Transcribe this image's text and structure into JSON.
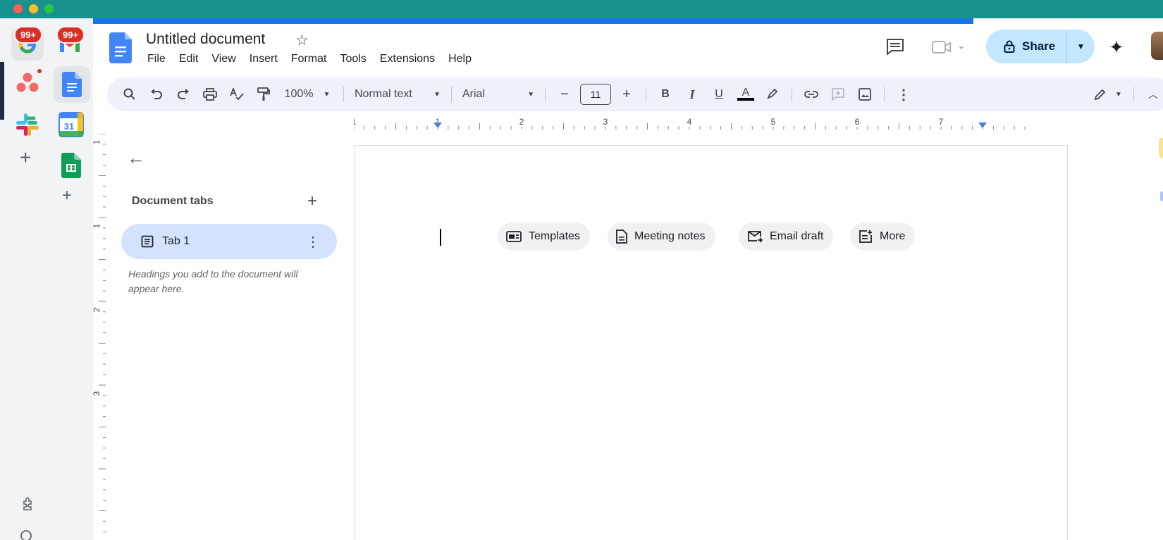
{
  "window": {
    "controls": [
      "close",
      "minimize",
      "maximize"
    ]
  },
  "rail": {
    "apps": [
      {
        "name": "Google",
        "badge": "99+"
      },
      {
        "name": "Gmail",
        "badge": "99+"
      },
      {
        "name": "Asana"
      },
      {
        "name": "Docs"
      },
      {
        "name": "Slack"
      },
      {
        "name": "Calendar",
        "label": "31"
      },
      {
        "name": "Sheets"
      }
    ],
    "add": "+"
  },
  "header": {
    "title": "Untitled document",
    "star": "☆",
    "menu": [
      "File",
      "Edit",
      "View",
      "Insert",
      "Format",
      "Tools",
      "Extensions",
      "Help"
    ],
    "share_label": "Share"
  },
  "toolbar": {
    "zoom": "100%",
    "style": "Normal text",
    "font": "Arial",
    "font_size": "11",
    "bold": "B",
    "italic": "I",
    "underline": "U",
    "text_color": "A",
    "minus": "−",
    "plus": "+"
  },
  "ruler": {
    "labels": [
      "1",
      "1",
      "2",
      "3",
      "4",
      "5",
      "6",
      "7"
    ]
  },
  "vruler": {
    "labels": [
      "1",
      "1",
      "2",
      "3"
    ]
  },
  "sidebar": {
    "heading": "Document tabs",
    "add": "+",
    "tabs": [
      {
        "label": "Tab 1"
      }
    ],
    "hint": "Headings you add to the document will appear here."
  },
  "chips": [
    {
      "label": "Templates",
      "icon": "templates-icon"
    },
    {
      "label": "Meeting notes",
      "icon": "document-icon"
    },
    {
      "label": "Email draft",
      "icon": "email-icon"
    },
    {
      "label": "More",
      "icon": "more-icon"
    }
  ],
  "colors": {
    "topbar": "#18918f",
    "accent": "#1a73e8",
    "share_bg": "#c2e7ff",
    "toolbar_bg": "#edf2fa",
    "tab_active": "#d3e3fd"
  }
}
